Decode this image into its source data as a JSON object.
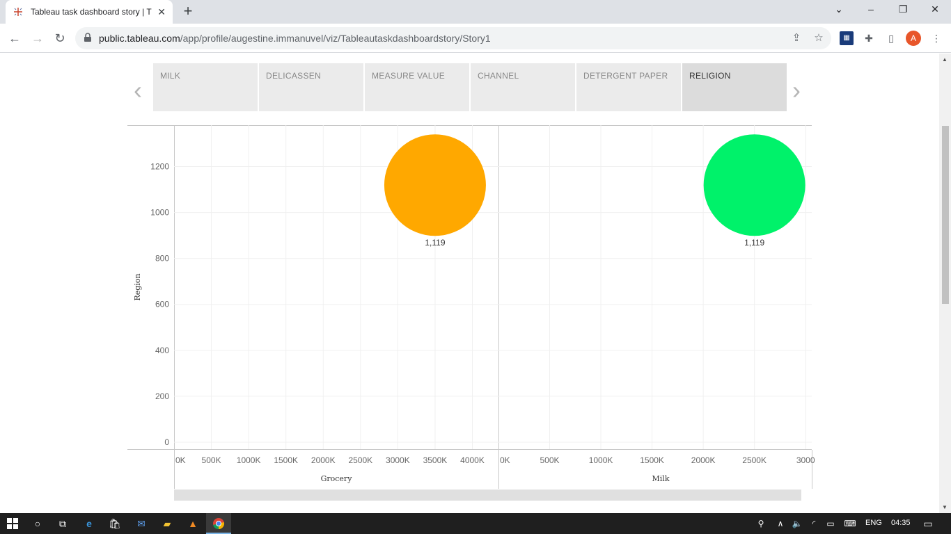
{
  "browser": {
    "tab_title": "Tableau task dashboard story | T",
    "url_domain": "public.tableau.com",
    "url_path": "/app/profile/augestine.immanuvel/viz/Tableautaskdashboardstory/Story1",
    "avatar_letter": "A"
  },
  "story": {
    "points": [
      {
        "label": "MILK"
      },
      {
        "label": "DELICASSEN"
      },
      {
        "label": "MEASURE VALUE"
      },
      {
        "label": "CHANNEL"
      },
      {
        "label": "DETERGENT PAPER"
      },
      {
        "label": "RELIGION"
      }
    ],
    "active_index": 5
  },
  "chart_data": [
    {
      "type": "scatter",
      "xlabel": "Grocery",
      "ylabel": "Region",
      "x_ticks": [
        "0K",
        "500K",
        "1000K",
        "1500K",
        "2000K",
        "2500K",
        "3000K",
        "3500K",
        "4000K"
      ],
      "y_ticks": [
        "0",
        "200",
        "400",
        "600",
        "800",
        "1000",
        "1200"
      ],
      "xlim": [
        0,
        4350
      ],
      "ylim": [
        0,
        1380
      ],
      "points": [
        {
          "x": 3500,
          "y": 1119,
          "label": "1,119",
          "color": "#FFA800"
        }
      ]
    },
    {
      "type": "scatter",
      "xlabel": "Milk",
      "ylabel": "Region",
      "x_ticks": [
        "0K",
        "500K",
        "1000K",
        "1500K",
        "2000K",
        "2500K",
        "3000"
      ],
      "y_ticks": [
        "0",
        "200",
        "400",
        "600",
        "800",
        "1000",
        "1200"
      ],
      "xlim": [
        0,
        3060
      ],
      "ylim": [
        0,
        1380
      ],
      "points": [
        {
          "x": 2500,
          "y": 1119,
          "label": "1,119",
          "color": "#00F26A"
        }
      ]
    }
  ],
  "taskbar": {
    "language": "ENG",
    "time": "04:35"
  }
}
